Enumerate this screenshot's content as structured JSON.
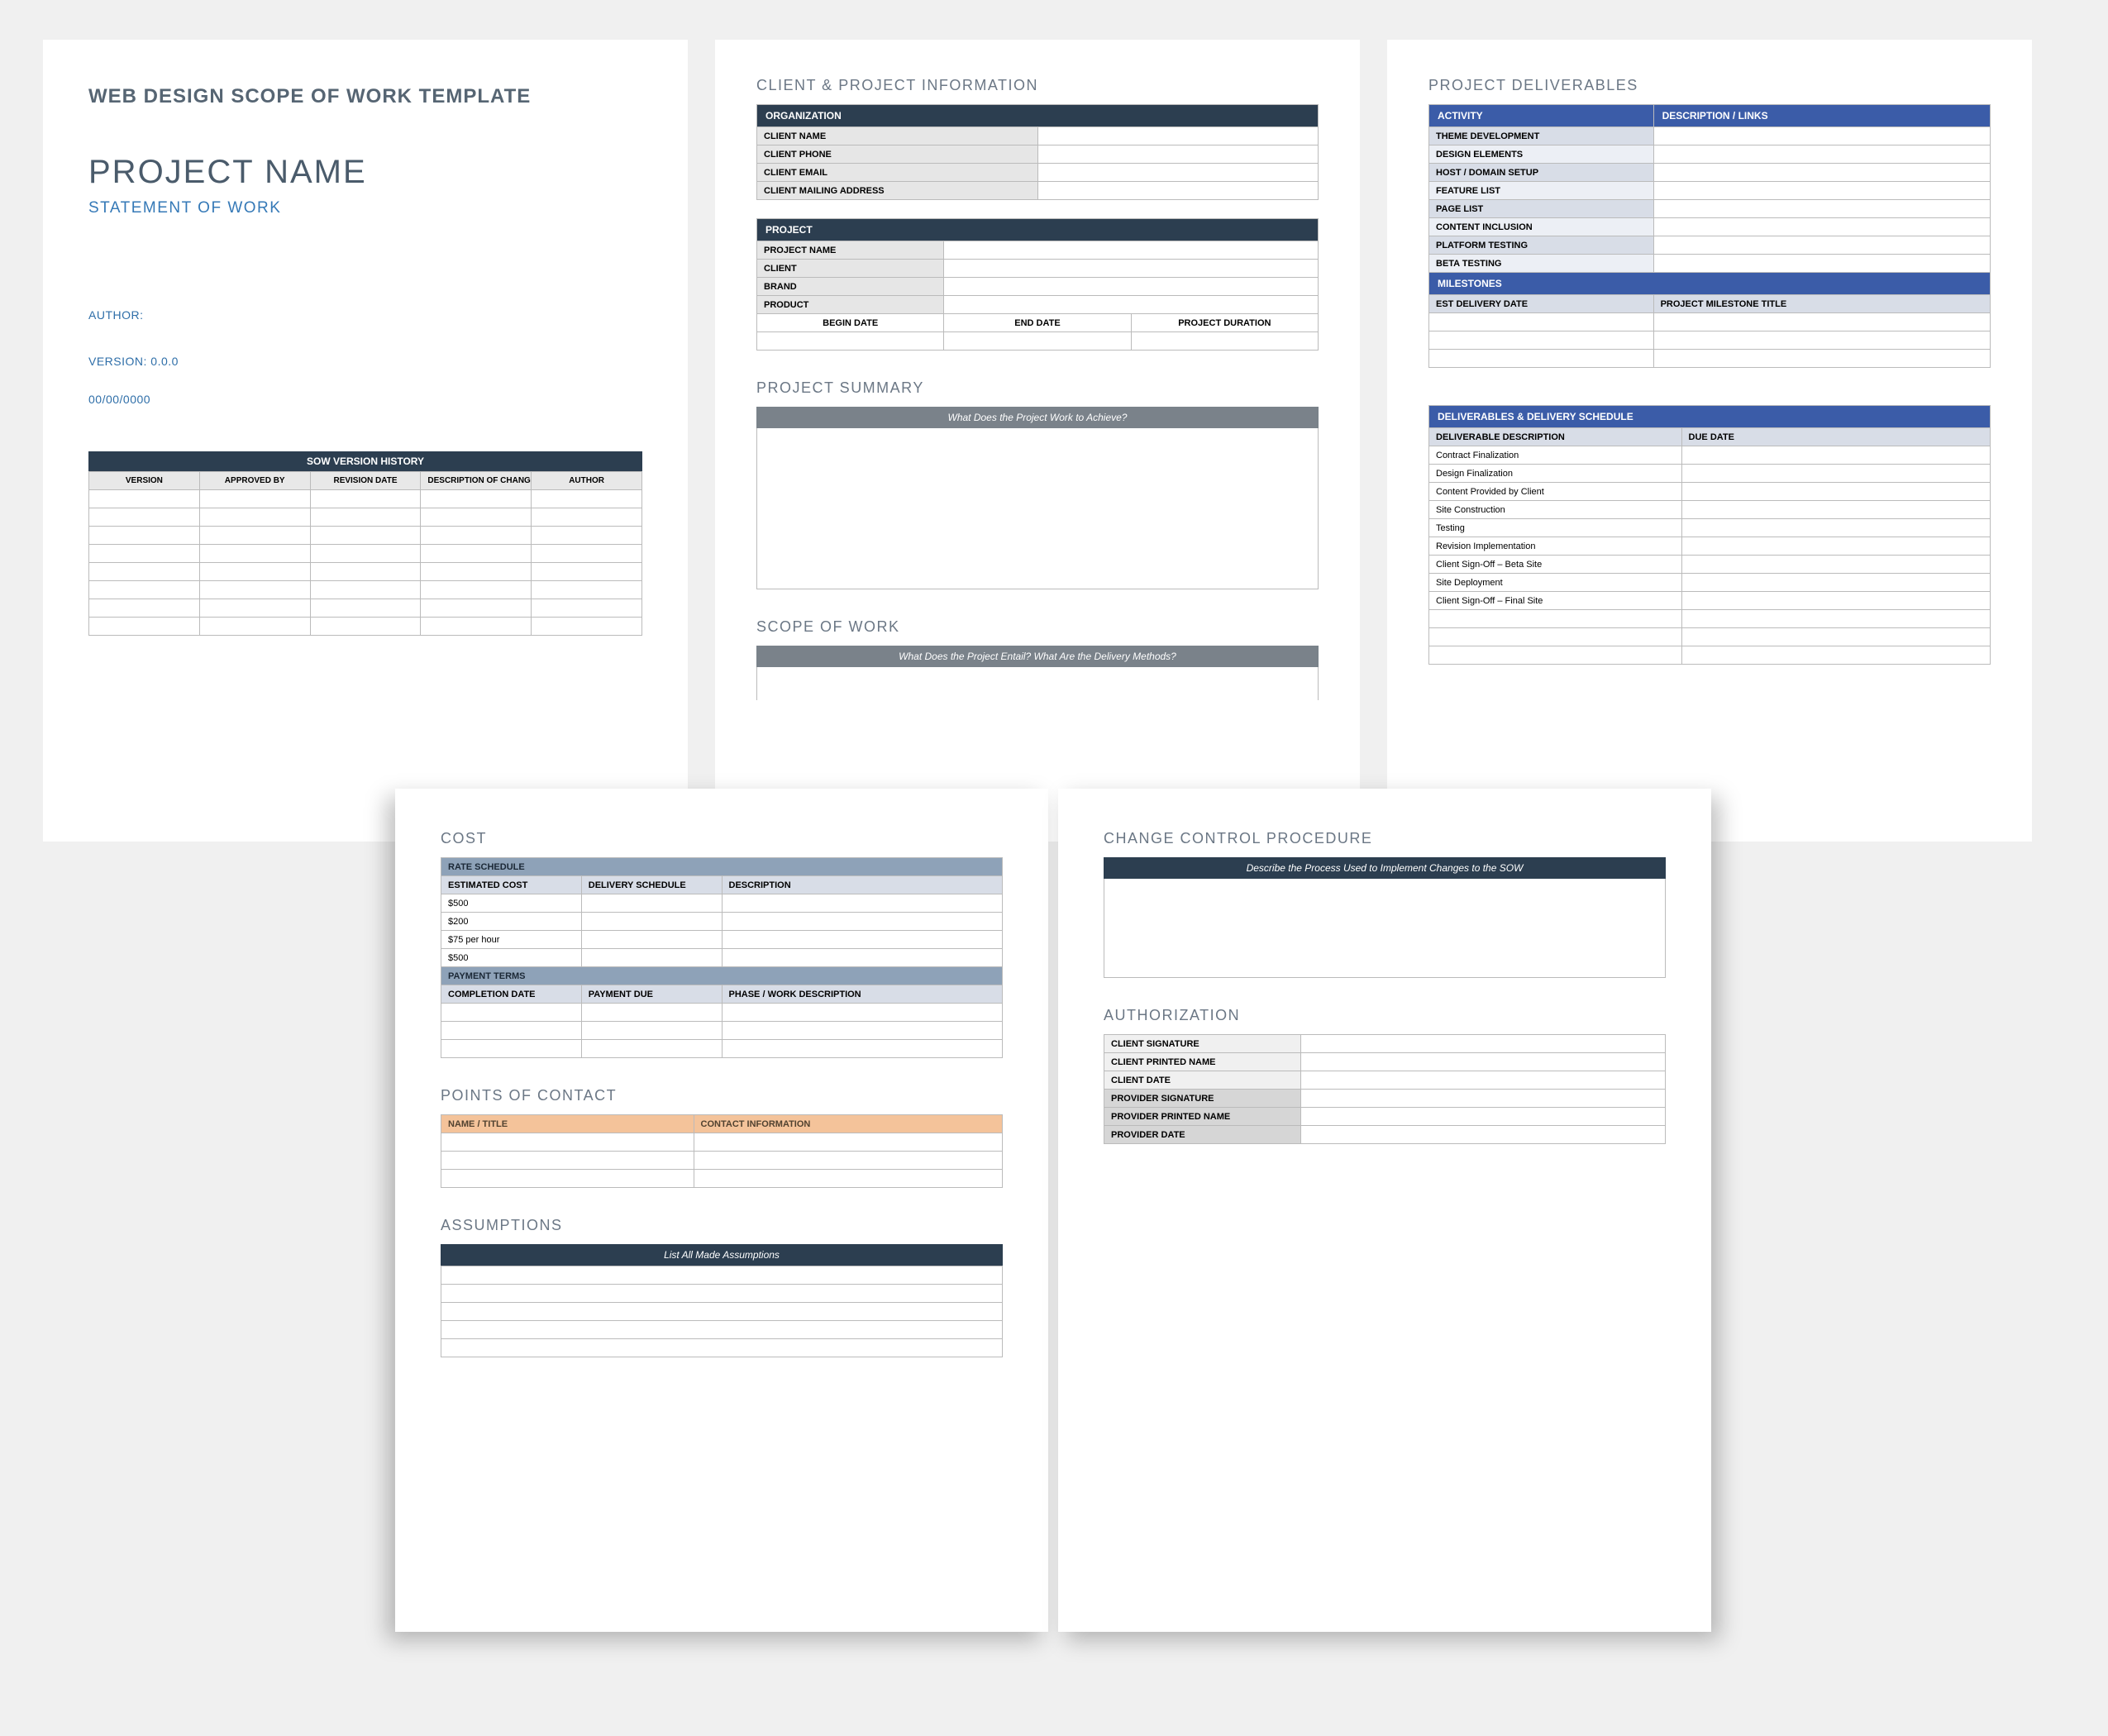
{
  "page1": {
    "doc_title": "WEB DESIGN SCOPE OF WORK TEMPLATE",
    "project_name": "PROJECT NAME",
    "subtitle": "STATEMENT OF WORK",
    "author_label": "AUTHOR:",
    "version_label": "VERSION: 0.0.0",
    "date_label": "00/00/0000",
    "version_history": {
      "title": "SOW VERSION HISTORY",
      "cols": [
        "VERSION",
        "APPROVED BY",
        "REVISION DATE",
        "DESCRIPTION OF CHANGE",
        "AUTHOR"
      ],
      "blank_rows": 8
    }
  },
  "page2": {
    "client_info_title": "CLIENT & PROJECT INFORMATION",
    "org_header": "ORGANIZATION",
    "org_rows": [
      "CLIENT NAME",
      "CLIENT  PHONE",
      "CLIENT EMAIL",
      "CLIENT MAILING ADDRESS"
    ],
    "project_header": "PROJECT",
    "project_rows": [
      "PROJECT NAME",
      "CLIENT",
      "BRAND",
      "PRODUCT"
    ],
    "date_cols": [
      "BEGIN DATE",
      "END DATE",
      "PROJECT DURATION"
    ],
    "summary_title": "PROJECT SUMMARY",
    "summary_prompt": "What Does the Project Work to Achieve?",
    "scope_title": "SCOPE OF WORK",
    "scope_prompt": "What Does the Project Entail? What Are the Delivery Methods?"
  },
  "page3": {
    "deliverables_title": "PROJECT DELIVERABLES",
    "activity_cols": [
      "ACTIVITY",
      "DESCRIPTION / LINKS"
    ],
    "activities": [
      "THEME DEVELOPMENT",
      "DESIGN ELEMENTS",
      "HOST / DOMAIN SETUP",
      "FEATURE LIST",
      "PAGE LIST",
      "CONTENT INCLUSION",
      "PLATFORM TESTING",
      "BETA TESTING"
    ],
    "milestones_header": "MILESTONES",
    "milestones_cols": [
      "EST DELIVERY DATE",
      "PROJECT MILESTONE TITLE"
    ],
    "milestones_blank": 3,
    "schedule_header": "DELIVERABLES & DELIVERY SCHEDULE",
    "schedule_cols": [
      "DELIVERABLE DESCRIPTION",
      "DUE DATE"
    ],
    "schedule_rows": [
      "Contract Finalization",
      "Design Finalization",
      "Content Provided by Client",
      "Site Construction",
      "Testing",
      "Revision Implementation",
      "Client Sign-Off – Beta Site",
      "Site Deployment",
      "Client Sign-Off – Final Site"
    ],
    "schedule_blank": 3
  },
  "page4": {
    "cost_title": "COST",
    "rate_header": "RATE SCHEDULE",
    "rate_cols": [
      "ESTIMATED COST",
      "DELIVERY SCHEDULE",
      "DESCRIPTION"
    ],
    "rate_rows": [
      "$500",
      "$200",
      "$75 per hour",
      "$500"
    ],
    "payment_header": "PAYMENT TERMS",
    "payment_cols": [
      "COMPLETION DATE",
      "PAYMENT DUE",
      "PHASE / WORK DESCRIPTION"
    ],
    "payment_blank": 3,
    "contacts_title": "POINTS OF CONTACT",
    "contacts_cols": [
      "NAME / TITLE",
      "CONTACT INFORMATION"
    ],
    "contacts_blank": 3,
    "assumptions_title": "ASSUMPTIONS",
    "assumptions_prompt": "List All Made Assumptions",
    "assumptions_blank": 5
  },
  "page5": {
    "change_title": "CHANGE CONTROL PROCEDURE",
    "change_prompt": "Describe the Process Used to Implement Changes to the SOW",
    "auth_title": "AUTHORIZATION",
    "auth_rows_light": [
      "CLIENT SIGNATURE",
      "CLIENT PRINTED NAME",
      "CLIENT DATE"
    ],
    "auth_rows_dark": [
      "PROVIDER SIGNATURE",
      "PROVIDER PRINTED NAME",
      "PROVIDER DATE"
    ]
  }
}
